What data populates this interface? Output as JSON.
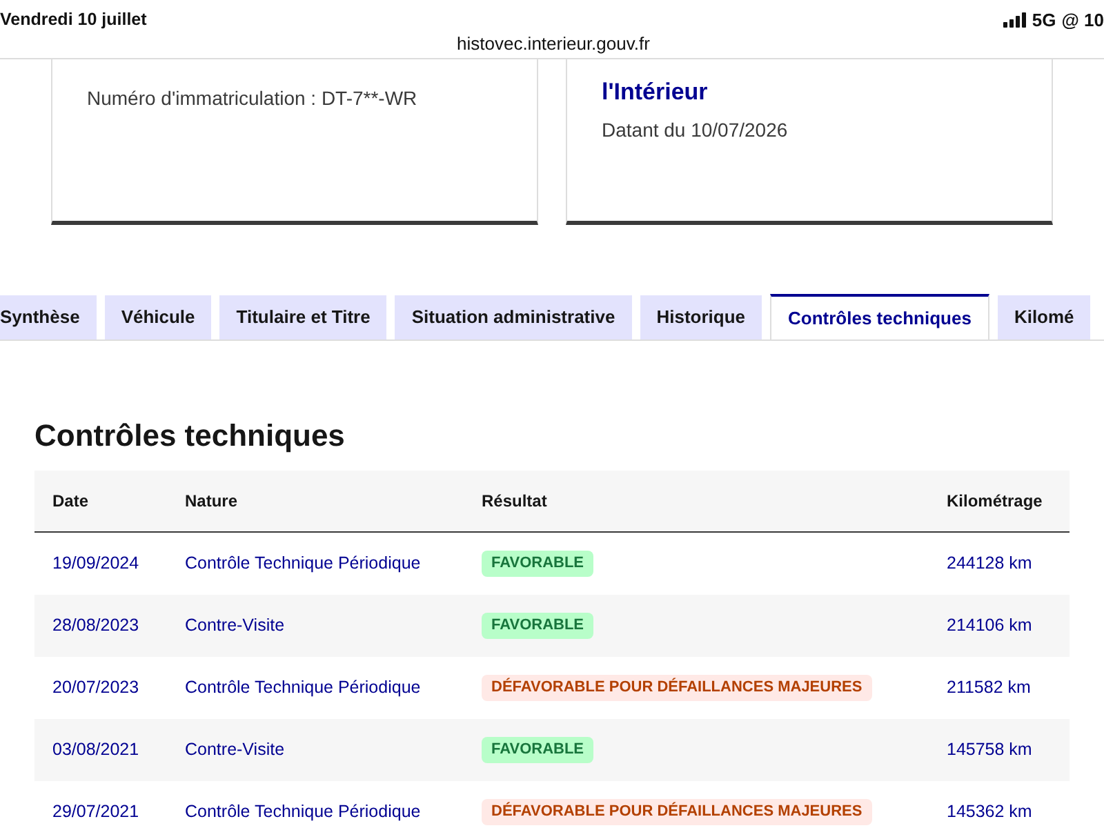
{
  "status_bar": {
    "date": "Vendredi 10 juillet",
    "url": "histovec.interieur.gouv.fr",
    "network": "5G",
    "battery_text": "@ 10"
  },
  "cards": [
    {
      "subtitle": "Numéro d'immatriculation : DT-7**-WR"
    },
    {
      "title": "l'Intérieur",
      "subtitle": "Datant du 10/07/2026"
    }
  ],
  "tabs": [
    {
      "label": "Synthèse",
      "selected": false
    },
    {
      "label": "Véhicule",
      "selected": false
    },
    {
      "label": "Titulaire et Titre",
      "selected": false
    },
    {
      "label": "Situation administrative",
      "selected": false
    },
    {
      "label": "Historique",
      "selected": false
    },
    {
      "label": "Contrôles techniques",
      "selected": true
    },
    {
      "label": "Kilomé",
      "selected": false
    }
  ],
  "section": {
    "title": "Contrôles techniques"
  },
  "table": {
    "columns": [
      "Date",
      "Nature",
      "Résultat",
      "Kilométrage"
    ],
    "rows": [
      {
        "date": "19/09/2024",
        "nature": "Contrôle Technique Périodique",
        "result": {
          "label": "FAVORABLE",
          "kind": "success"
        },
        "mileage": "244128 km"
      },
      {
        "date": "28/08/2023",
        "nature": "Contre-Visite",
        "result": {
          "label": "FAVORABLE",
          "kind": "success"
        },
        "mileage": "214106 km"
      },
      {
        "date": "20/07/2023",
        "nature": "Contrôle Technique Périodique",
        "result": {
          "label": "DÉFAVORABLE POUR DÉFAILLANCES MAJEURES",
          "kind": "warning"
        },
        "mileage": "211582 km"
      },
      {
        "date": "03/08/2021",
        "nature": "Contre-Visite",
        "result": {
          "label": "FAVORABLE",
          "kind": "success"
        },
        "mileage": "145758 km"
      },
      {
        "date": "29/07/2021",
        "nature": "Contrôle Technique Périodique",
        "result": {
          "label": "DÉFAVORABLE POUR DÉFAILLANCES MAJEURES",
          "kind": "warning"
        },
        "mileage": "145362 km"
      }
    ]
  }
}
